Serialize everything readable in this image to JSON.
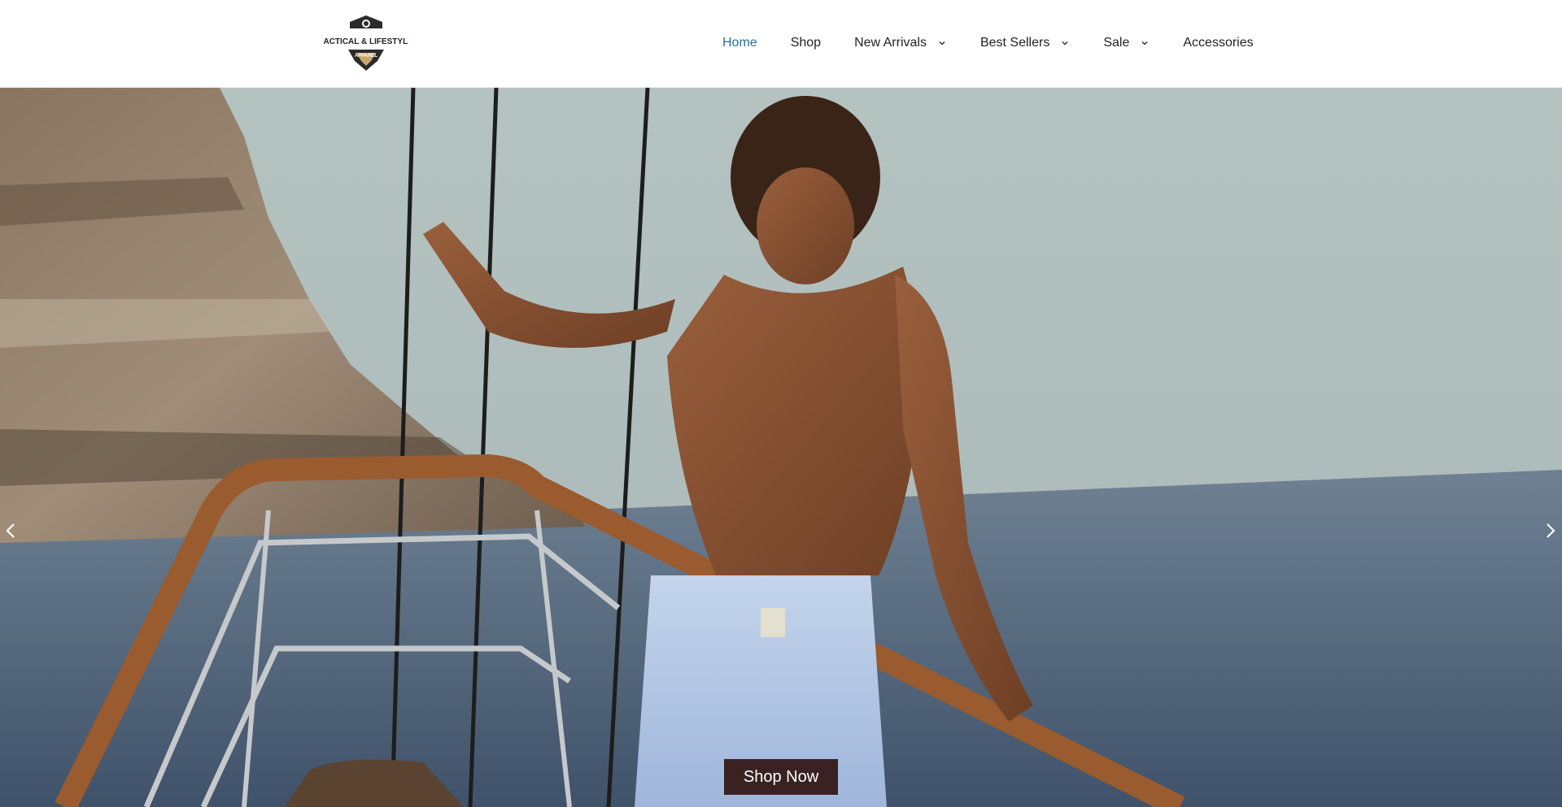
{
  "brand": {
    "logo_line1": "TACTICAL & LIFESTYLE",
    "logo_line2": "APPAREL"
  },
  "nav": {
    "items": [
      {
        "label": "Home",
        "active": true,
        "dropdown": false
      },
      {
        "label": "Shop",
        "active": false,
        "dropdown": false
      },
      {
        "label": "New Arrivals",
        "active": false,
        "dropdown": true
      },
      {
        "label": "Best Sellers",
        "active": false,
        "dropdown": true
      },
      {
        "label": "Sale",
        "active": false,
        "dropdown": true
      },
      {
        "label": "Accessories",
        "active": false,
        "dropdown": false
      }
    ]
  },
  "hero": {
    "cta_label": "Shop Now",
    "prev_icon": "chevron-left-icon",
    "next_icon": "chevron-right-icon"
  },
  "colors": {
    "nav_active": "#2a6f97",
    "cta_background": "#3a2222"
  }
}
